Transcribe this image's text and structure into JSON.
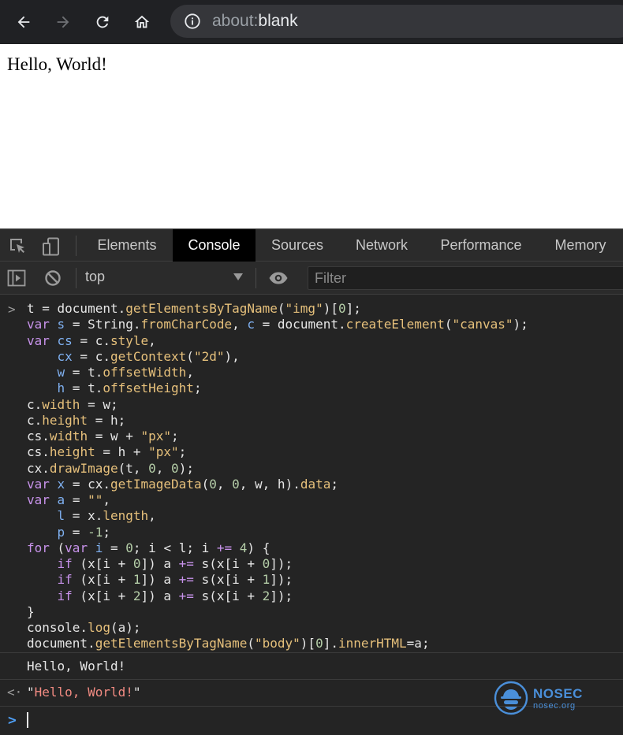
{
  "browser": {
    "address_scheme": "about:",
    "address_path": "blank",
    "icons": [
      "back-arrow-icon",
      "forward-arrow-icon",
      "reload-icon",
      "home-icon",
      "info-icon"
    ]
  },
  "page": {
    "content_text": "Hello, World!"
  },
  "devtools": {
    "tabs": [
      {
        "label": "Elements",
        "active": false
      },
      {
        "label": "Console",
        "active": true
      },
      {
        "label": "Sources",
        "active": false
      },
      {
        "label": "Network",
        "active": false
      },
      {
        "label": "Performance",
        "active": false
      },
      {
        "label": "Memory",
        "active": false
      }
    ],
    "toolbar": {
      "context": "top",
      "filter_placeholder": "Filter"
    },
    "console": {
      "input_code": [
        [
          [
            "t = document.",
            "plain"
          ],
          [
            "getElementsByTagName",
            "prop"
          ],
          [
            "(",
            "plain"
          ],
          [
            "\"img\"",
            "str"
          ],
          [
            ")[",
            "plain"
          ],
          [
            "0",
            "num"
          ],
          [
            "];",
            "plain"
          ]
        ],
        [
          [
            "var",
            "kw"
          ],
          [
            " ",
            "plain"
          ],
          [
            "s",
            "var"
          ],
          [
            " = String.",
            "plain"
          ],
          [
            "fromCharCode",
            "prop"
          ],
          [
            ", ",
            "plain"
          ],
          [
            "c",
            "var"
          ],
          [
            " = document.",
            "plain"
          ],
          [
            "createElement",
            "prop"
          ],
          [
            "(",
            "plain"
          ],
          [
            "\"canvas\"",
            "str"
          ],
          [
            ");",
            "plain"
          ]
        ],
        [
          [
            "var",
            "kw"
          ],
          [
            " ",
            "plain"
          ],
          [
            "cs",
            "var"
          ],
          [
            " = c.",
            "plain"
          ],
          [
            "style",
            "prop"
          ],
          [
            ",",
            "plain"
          ]
        ],
        [
          [
            "    ",
            "plain"
          ],
          [
            "cx",
            "var"
          ],
          [
            " = c.",
            "plain"
          ],
          [
            "getContext",
            "prop"
          ],
          [
            "(",
            "plain"
          ],
          [
            "\"2d\"",
            "str"
          ],
          [
            "),",
            "plain"
          ]
        ],
        [
          [
            "    ",
            "plain"
          ],
          [
            "w",
            "var"
          ],
          [
            " = t.",
            "plain"
          ],
          [
            "offsetWidth",
            "prop"
          ],
          [
            ",",
            "plain"
          ]
        ],
        [
          [
            "    ",
            "plain"
          ],
          [
            "h",
            "var"
          ],
          [
            " = t.",
            "plain"
          ],
          [
            "offsetHeight",
            "prop"
          ],
          [
            ";",
            "plain"
          ]
        ],
        [
          [
            "c.",
            "plain"
          ],
          [
            "width",
            "prop"
          ],
          [
            " = w;",
            "plain"
          ]
        ],
        [
          [
            "c.",
            "plain"
          ],
          [
            "height",
            "prop"
          ],
          [
            " = h;",
            "plain"
          ]
        ],
        [
          [
            "cs.",
            "plain"
          ],
          [
            "width",
            "prop"
          ],
          [
            " = w + ",
            "plain"
          ],
          [
            "\"px\"",
            "str"
          ],
          [
            ";",
            "plain"
          ]
        ],
        [
          [
            "cs.",
            "plain"
          ],
          [
            "height",
            "prop"
          ],
          [
            " = h + ",
            "plain"
          ],
          [
            "\"px\"",
            "str"
          ],
          [
            ";",
            "plain"
          ]
        ],
        [
          [
            "cx.",
            "plain"
          ],
          [
            "drawImage",
            "prop"
          ],
          [
            "(t, ",
            "plain"
          ],
          [
            "0",
            "num"
          ],
          [
            ", ",
            "plain"
          ],
          [
            "0",
            "num"
          ],
          [
            ");",
            "plain"
          ]
        ],
        [
          [
            "var",
            "kw"
          ],
          [
            " ",
            "plain"
          ],
          [
            "x",
            "var"
          ],
          [
            " = cx.",
            "plain"
          ],
          [
            "getImageData",
            "prop"
          ],
          [
            "(",
            "plain"
          ],
          [
            "0",
            "num"
          ],
          [
            ", ",
            "plain"
          ],
          [
            "0",
            "num"
          ],
          [
            ", w, h).",
            "plain"
          ],
          [
            "data",
            "prop"
          ],
          [
            ";",
            "plain"
          ]
        ],
        [
          [
            "var",
            "kw"
          ],
          [
            " ",
            "plain"
          ],
          [
            "a",
            "var"
          ],
          [
            " = ",
            "plain"
          ],
          [
            "\"\"",
            "str"
          ],
          [
            ",",
            "plain"
          ]
        ],
        [
          [
            "    ",
            "plain"
          ],
          [
            "l",
            "var"
          ],
          [
            " = x.",
            "plain"
          ],
          [
            "length",
            "prop"
          ],
          [
            ",",
            "plain"
          ]
        ],
        [
          [
            "    ",
            "plain"
          ],
          [
            "p",
            "var"
          ],
          [
            " = ",
            "plain"
          ],
          [
            "-1",
            "num"
          ],
          [
            ";",
            "plain"
          ]
        ],
        [
          [
            "for",
            "kw"
          ],
          [
            " (",
            "plain"
          ],
          [
            "var",
            "kw"
          ],
          [
            " ",
            "plain"
          ],
          [
            "i",
            "var"
          ],
          [
            " = ",
            "plain"
          ],
          [
            "0",
            "num"
          ],
          [
            "; i < l; i ",
            "plain"
          ],
          [
            "+=",
            "kw"
          ],
          [
            " ",
            "plain"
          ],
          [
            "4",
            "num"
          ],
          [
            ") {",
            "plain"
          ]
        ],
        [
          [
            "    ",
            "plain"
          ],
          [
            "if",
            "kw"
          ],
          [
            " (x[i + ",
            "plain"
          ],
          [
            "0",
            "num"
          ],
          [
            "]) a ",
            "plain"
          ],
          [
            "+=",
            "kw"
          ],
          [
            " s(x[i + ",
            "plain"
          ],
          [
            "0",
            "num"
          ],
          [
            "]);",
            "plain"
          ]
        ],
        [
          [
            "    ",
            "plain"
          ],
          [
            "if",
            "kw"
          ],
          [
            " (x[i + ",
            "plain"
          ],
          [
            "1",
            "num"
          ],
          [
            "]) a ",
            "plain"
          ],
          [
            "+=",
            "kw"
          ],
          [
            " s(x[i + ",
            "plain"
          ],
          [
            "1",
            "num"
          ],
          [
            "]);",
            "plain"
          ]
        ],
        [
          [
            "    ",
            "plain"
          ],
          [
            "if",
            "kw"
          ],
          [
            " (x[i + ",
            "plain"
          ],
          [
            "2",
            "num"
          ],
          [
            "]) a ",
            "plain"
          ],
          [
            "+=",
            "kw"
          ],
          [
            " s(x[i + ",
            "plain"
          ],
          [
            "2",
            "num"
          ],
          [
            "]);",
            "plain"
          ]
        ],
        [
          [
            "}",
            "plain"
          ]
        ],
        [
          [
            "console.",
            "plain"
          ],
          [
            "log",
            "prop"
          ],
          [
            "(a);",
            "plain"
          ]
        ],
        [
          [
            "document.",
            "plain"
          ],
          [
            "getElementsByTagName",
            "prop"
          ],
          [
            "(",
            "plain"
          ],
          [
            "\"body\"",
            "str"
          ],
          [
            ")[",
            "plain"
          ],
          [
            "0",
            "num"
          ],
          [
            "].",
            "plain"
          ],
          [
            "innerHTML",
            "prop"
          ],
          [
            "=a;",
            "plain"
          ]
        ]
      ],
      "log_output": "Hello, World!",
      "return_value": "Hello, World!",
      "input_caret": ">",
      "result_caret": "<·",
      "prompt_caret": ">"
    }
  },
  "watermark": {
    "brand": "NOSEC",
    "site": "nosec.org"
  },
  "colors": {
    "browser_chrome": "#202124",
    "devtools_bg": "#242424",
    "keyword": "#c792ea",
    "property": "#e6c07b",
    "string_result": "#f28b82",
    "prompt_blue": "#4f9ff5",
    "watermark_blue": "#4a8fd9"
  }
}
